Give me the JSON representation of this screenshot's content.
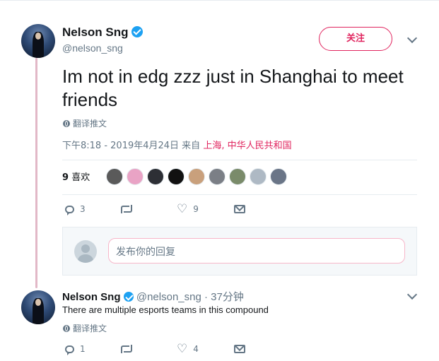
{
  "main_tweet": {
    "author_name": "Nelson Sng",
    "handle": "@nelson_sng",
    "follow_label": "关注",
    "text": "Im not in edg zzz just in Shanghai to meet friends",
    "translate_label": "翻译推文",
    "timestamp": "下午8:18 - 2019年4月24日 来自",
    "location": "上海, 中华人民共和国",
    "likes_count": "9",
    "likes_label": "喜欢",
    "reply_count": "3",
    "retweet_count": "",
    "like_count": "9"
  },
  "likers": [
    {
      "name": "liker-1",
      "color": "#5a5a5a"
    },
    {
      "name": "liker-2",
      "color": "#e9a3c5"
    },
    {
      "name": "liker-3",
      "color": "#2d2f35"
    },
    {
      "name": "liker-4",
      "color": "#111111"
    },
    {
      "name": "liker-5",
      "color": "#c9a07c"
    },
    {
      "name": "liker-6",
      "color": "#7b7f86"
    },
    {
      "name": "liker-7",
      "color": "#7a8b6a"
    },
    {
      "name": "liker-8",
      "color": "#aeb9c4"
    },
    {
      "name": "liker-9",
      "color": "#6a7587"
    }
  ],
  "reply_composer": {
    "placeholder": "发布你的回复"
  },
  "reply_tweet": {
    "author_name": "Nelson Sng",
    "handle": "@nelson_sng",
    "time": "37分钟",
    "separator": "·",
    "text": "There are multiple esports teams in this compound",
    "translate_label": "翻译推文",
    "reply_count": "1",
    "like_count": "4"
  },
  "colors": {
    "accent": "#e0245e",
    "verified": "#1da1f2",
    "muted": "#657786",
    "thread_line": "#e2b8c7"
  }
}
